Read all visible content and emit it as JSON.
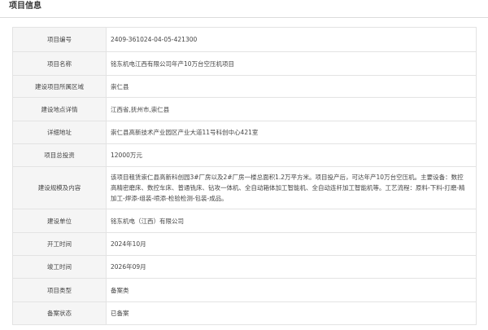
{
  "section": {
    "title": "项目信息"
  },
  "rows": [
    {
      "label": "项目编号",
      "value": "2409-361024-04-05-421300"
    },
    {
      "label": "项目名称",
      "value": "铭东机电江西有限公司年产10万台空压机项目"
    },
    {
      "label": "建设项目所属区域",
      "value": "崇仁县"
    },
    {
      "label": "建设地点详情",
      "value": "江西省,抚州市,崇仁县"
    },
    {
      "label": "详细地址",
      "value": "崇仁县高新技术产业园区产业大道11号科创中心421室"
    },
    {
      "label": "项目总投资",
      "value": "12000万元"
    },
    {
      "label": "建设规模及内容",
      "value": "该项目租赁崇仁县高新科创园3#厂房以及2#厂房一楼总面积1.2万平方米。项目投产后，可达年产10万台空压机。主要设备：数控高精密磨床、数控车床、普通铣床、钻攻一体机、全自动箱体加工智能机、全自动连杆加工智能机等。工艺流程：原料-下料-打磨-精加工-焊添-组装-喷添-检验检测-包装-成品。"
    },
    {
      "label": "建设单位",
      "value": "铭东机电（江西）有限公司"
    },
    {
      "label": "开工时间",
      "value": "2024年10月"
    },
    {
      "label": "竣工时间",
      "value": "2026年09月"
    },
    {
      "label": "项目类型",
      "value": "备案类"
    },
    {
      "label": "备案状态",
      "value": "已备案"
    }
  ]
}
